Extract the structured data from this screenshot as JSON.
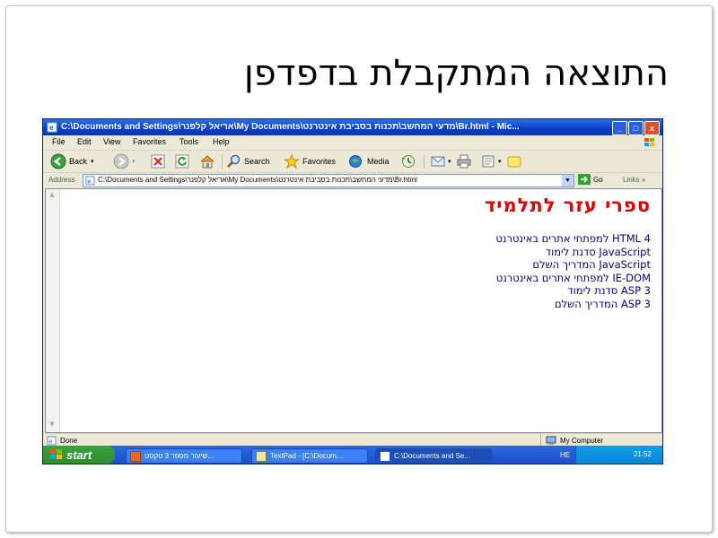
{
  "slide": {
    "title": "התוצאה המתקבלת בדפדפן"
  },
  "window": {
    "title": "C:\\Documents and Settings\\אריאל קלפנר\\My Documents\\מדעי המחשב\\תכנות בסביבת אינטרנט\\Br.html - Mic...",
    "controls": {
      "minimize": "_",
      "maximize": "□",
      "close": "x"
    }
  },
  "menu": [
    "File",
    "Edit",
    "View",
    "Favorites",
    "Tools",
    "Help"
  ],
  "toolbar": {
    "back": "Back",
    "search": "Search",
    "favorites": "Favorites",
    "media": "Media"
  },
  "address": {
    "label": "Address",
    "value": "C:\\Documents and Settings\\אריאל קלפנר\\My Documents\\מדעי המחשב\\תכנות בסביבת אינטרנט\\Br.html",
    "go": "Go",
    "links": "Links"
  },
  "page": {
    "heading": "ספרי עזר לתלמיד",
    "links": [
      "HTML 4 למפתחי אתרים באינטרנט",
      "JavaScript סדנת לימוד",
      "JavaScript המדריך השלם",
      "IE-DOM למפתחי אתרים באינטרנט",
      "ASP 3 סדנת לימוד",
      "ASP 3 המדריך השלם"
    ]
  },
  "status": {
    "left": "Done",
    "zone": "My Computer"
  },
  "taskbar": {
    "start": "start",
    "tasks": [
      "שיעור מספר 3 טקסט...",
      "TextPad - [C:\\Docum...",
      "C:\\Documents and Se..."
    ],
    "language": "HE",
    "clock": "21:52"
  },
  "colors": {
    "heading": "#e00000",
    "links": "#000080",
    "titlebar": "#0a3fc4",
    "taskbar": "#245edb",
    "start": "#3ea141"
  }
}
